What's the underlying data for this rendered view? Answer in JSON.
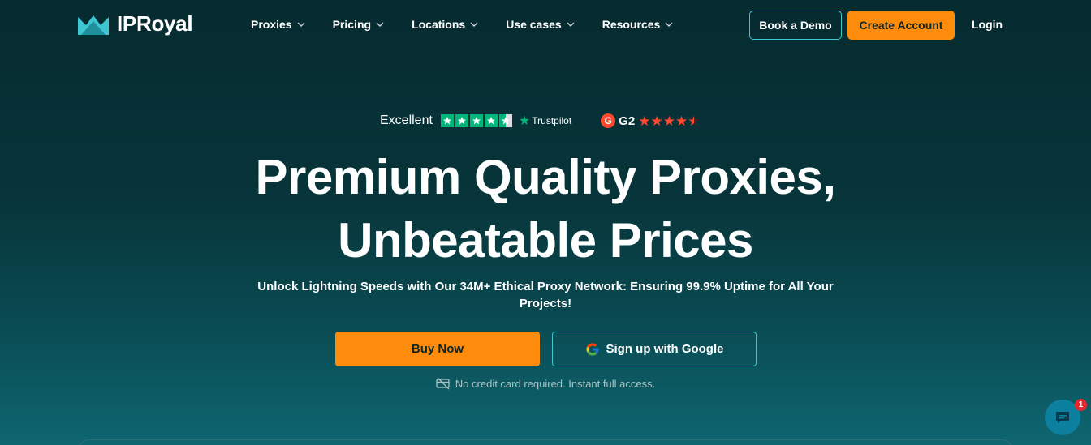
{
  "header": {
    "logo_text": "IPRoyal",
    "nav": [
      {
        "label": "Proxies"
      },
      {
        "label": "Pricing"
      },
      {
        "label": "Locations"
      },
      {
        "label": "Use cases"
      },
      {
        "label": "Resources"
      }
    ],
    "book_demo_label": "Book a Demo",
    "create_account_label": "Create Account",
    "login_label": "Login"
  },
  "ratings": {
    "trustpilot_label": "Excellent",
    "trustpilot_brand": "Trustpilot",
    "trustpilot_stars": 4.5,
    "g2_label": "G2",
    "g2_stars": 4.5
  },
  "hero": {
    "title_line1": "Premium Quality Proxies,",
    "title_line2": "Unbeatable Prices",
    "subtitle_line1": "Unlock Lightning Speeds with Our 34M+ Ethical Proxy Network: Ensuring 99.9% Uptime for All Your",
    "subtitle_line2": "Projects!",
    "buy_now_label": "Buy Now",
    "google_signup_label": "Sign up with Google",
    "note": "No credit card required. Instant full access."
  },
  "chat": {
    "badge_count": "1"
  },
  "colors": {
    "accent_orange": "#fd8c0c",
    "accent_teal": "#3fc6d3",
    "trustpilot_green": "#00b67a",
    "g2_red": "#ff492c",
    "background_dark": "#062b30"
  }
}
